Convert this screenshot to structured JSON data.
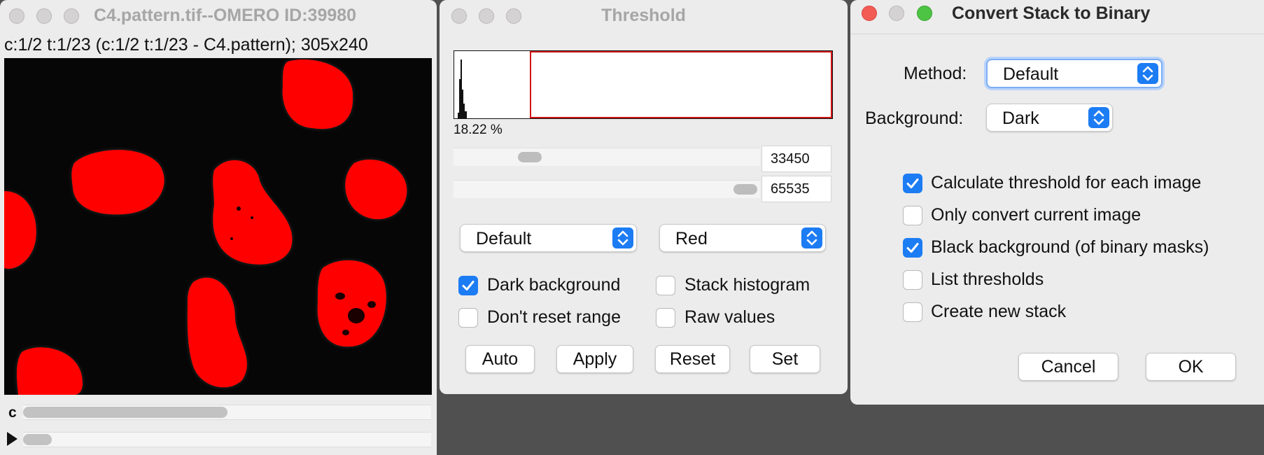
{
  "image_window": {
    "title": "C4.pattern.tif--OMERO ID:39980",
    "info": "c:1/2 t:1/23 (c:1/2 t:1/23 - C4.pattern); 305x240",
    "channel_label": "c",
    "channel_slider_position": 0.5,
    "time_slider_position": 0.07
  },
  "threshold": {
    "title": "Threshold",
    "percent": "18.22 %",
    "min_value": "33450",
    "max_value": "65535",
    "min_slider_position": 0.23,
    "max_slider_position": 1.0,
    "method": "Default",
    "display": "Red",
    "checkboxes": [
      {
        "label": "Dark background",
        "checked": true
      },
      {
        "label": "Stack histogram",
        "checked": false
      },
      {
        "label": "Don't reset range",
        "checked": false
      },
      {
        "label": "Raw values",
        "checked": false
      }
    ],
    "buttons": {
      "auto": "Auto",
      "apply": "Apply",
      "reset": "Reset",
      "set": "Set"
    }
  },
  "convert": {
    "title": "Convert Stack to Binary",
    "method_label": "Method:",
    "method_value": "Default",
    "background_label": "Background:",
    "background_value": "Dark",
    "options": [
      {
        "label": "Calculate threshold for each image",
        "checked": true
      },
      {
        "label": "Only convert current image",
        "checked": false
      },
      {
        "label": "Black background (of binary masks)",
        "checked": true
      },
      {
        "label": "List thresholds",
        "checked": false
      },
      {
        "label": "Create new stack",
        "checked": false
      }
    ],
    "cancel_label": "Cancel",
    "ok_label": "OK"
  },
  "colors": {
    "threshold_overlay": "#ff0000",
    "selection_outline": "#cf1414",
    "accent": "#1c7cf4"
  }
}
